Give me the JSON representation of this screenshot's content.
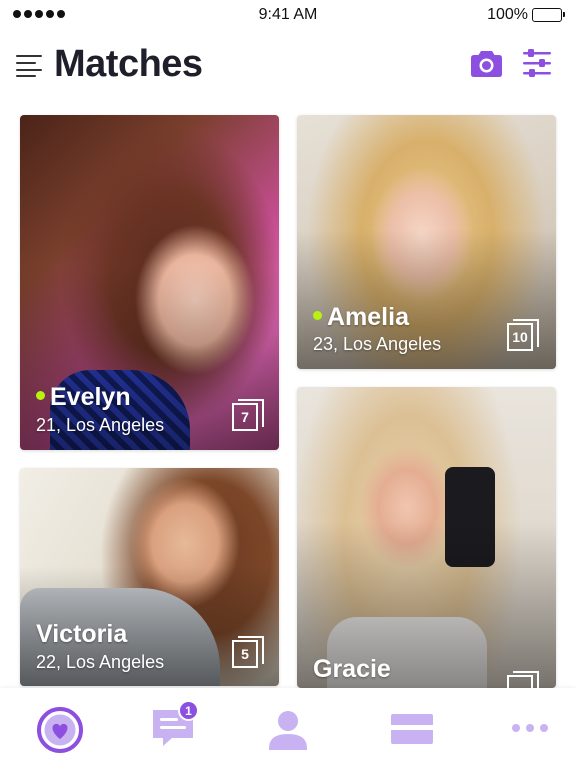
{
  "status_bar": {
    "time": "9:41 AM",
    "battery": "100%"
  },
  "header": {
    "title": "Matches",
    "menu_icon": "hamburger-menu-icon",
    "camera_icon": "camera-icon",
    "filter_icon": "filter-sliders-icon"
  },
  "matches": [
    {
      "name": "Evelyn",
      "details": "21, Los Angeles",
      "photos": "7",
      "online": true
    },
    {
      "name": "Amelia",
      "details": "23, Los Angeles",
      "photos": "10",
      "online": true
    },
    {
      "name": "Victoria",
      "details": "22, Los Angeles",
      "photos": "5",
      "online": false
    },
    {
      "name": "Gracie",
      "details": "",
      "photos": "",
      "online": false
    }
  ],
  "tab_bar": {
    "tabs": [
      {
        "icon": "matches-heart-icon",
        "active": true
      },
      {
        "icon": "messages-icon",
        "badge": "1"
      },
      {
        "icon": "profile-icon"
      },
      {
        "icon": "cards-icon"
      },
      {
        "icon": "more-icon"
      }
    ]
  },
  "colors": {
    "accent": "#8c4fe0",
    "accent_light": "#c9b2f1",
    "online": "#b8f20d",
    "title": "#1f1f2b"
  }
}
